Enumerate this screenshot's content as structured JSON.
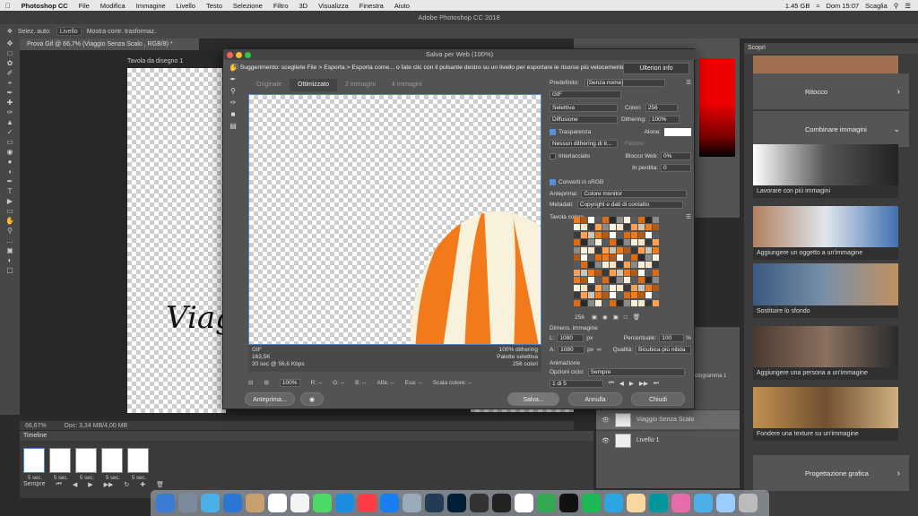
{
  "menubar": {
    "app": "Photoshop CC",
    "items": [
      "File",
      "Modifica",
      "Immagine",
      "Livello",
      "Testo",
      "Selezione",
      "Filtro",
      "3D",
      "Visualizza",
      "Finestra",
      "Aiuto"
    ],
    "storage": "1.45 GB",
    "clock": "Dom 15:07",
    "user": "Scaglia"
  },
  "ps_title": "Adobe Photoshop CC 2018",
  "options": {
    "autoselect": "Selez. auto:",
    "autoselect_value": "Livello",
    "transform": "Mostra contr. trasformaz."
  },
  "document_tab": "Prova Gif @ 66,7% (Viaggio Senza Scalo , RGB/8) *",
  "artboard_label": "Tavola da disegno 1",
  "script_text": "Viag",
  "statusbar": {
    "zoom": "66,67%",
    "doc": "Doc: 3,34 MB/4,00 MB"
  },
  "timeline": {
    "title": "Timeline",
    "frame_delay": "5 sec.",
    "loop": "Sempre",
    "frames": [
      "1",
      "2",
      "3",
      "4",
      "5"
    ]
  },
  "dialog": {
    "title": "Salva per Web (100%)",
    "hint": "Suggerimento: scegliete File > Esporta > Esporta come... o fate clic con il pulsante destro su un livello per esportare le risorse più velocemente",
    "info_button": "Ulteriori info",
    "tabs": [
      "Originale",
      "Ottimizzato",
      "2 immagini",
      "4 immagini"
    ],
    "active_tab": "Ottimizzato",
    "preview_info_left": [
      "GIF",
      "163,5K",
      "30 sec @ 56,6 Kbps"
    ],
    "preview_info_right": [
      "100% dithering",
      "Palette selettiva",
      "256 colori"
    ],
    "zoom": "100%",
    "status_fields": [
      "R: --",
      "G: --",
      "B: --",
      "Alfa: --",
      "Esa: --",
      "Scala colore: --"
    ],
    "buttons": {
      "preview": "Anteprima...",
      "save": "Salva...",
      "cancel": "Annulla",
      "done": "Chiudi"
    },
    "settings": {
      "preset_label": "Predefinito:",
      "preset_value": "[Senza nome]",
      "format": "GIF",
      "reduction": "Selettiva",
      "colors_label": "Colori:",
      "colors_value": "256",
      "dither_algo": "Diffusione",
      "dither_label": "Dithering:",
      "dither_value": "100%",
      "transparency": "Trasparenza",
      "matte_label": "Alone:",
      "trans_dither": "Nessun dithering di tr...",
      "amount_label": "Fattore:",
      "interlaced": "Interlacciato",
      "webSnap_label": "Blocco Web:",
      "webSnap_value": "0%",
      "lossy_label": "In perdita:",
      "lossy_value": "0",
      "srgb": "Converti in sRGB",
      "preview_label": "Anteprima:",
      "preview_value": "Colore monitor",
      "metadata_label": "Metadati:",
      "metadata_value": "Copyright e dati di contatto",
      "color_table": "Tavola colore",
      "color_count": "256",
      "size_title": "Dimens. immagine",
      "w_label": "L:",
      "w_value": "1080",
      "h_label": "A:",
      "h_value": "1080",
      "unit": "px",
      "percent_label": "Percentuale:",
      "percent_value": "100",
      "percent_unit": "%",
      "quality_label": "Qualità:",
      "quality_value": "Bicubica più nitida",
      "anim_title": "Animazione",
      "loop_label": "Opzioni ciclo:",
      "loop_value": "Sempre",
      "frame_counter": "1 di 5"
    }
  },
  "layers": [
    {
      "name": "Viaggio Senza Scalo"
    },
    {
      "name": "Livello 1"
    }
  ],
  "layers_fragment": "pe fotogramma 1",
  "discover": {
    "title": "Scopri",
    "cards": [
      "Ritocco",
      "Combinare immagini",
      "Progettazione grafica"
    ],
    "tutorials": [
      "Lavorare con più immagini",
      "Aggiungere un oggetto a un'immagine",
      "Sostituire lo sfondo",
      "Aggiungere una persona a un'immagine",
      "Fondere una texture su un'immagine"
    ]
  },
  "colors": {
    "balloon_orange": "#f27a1a",
    "balloon_cream": "#f8f1dc",
    "accent": "#4a86d0"
  }
}
